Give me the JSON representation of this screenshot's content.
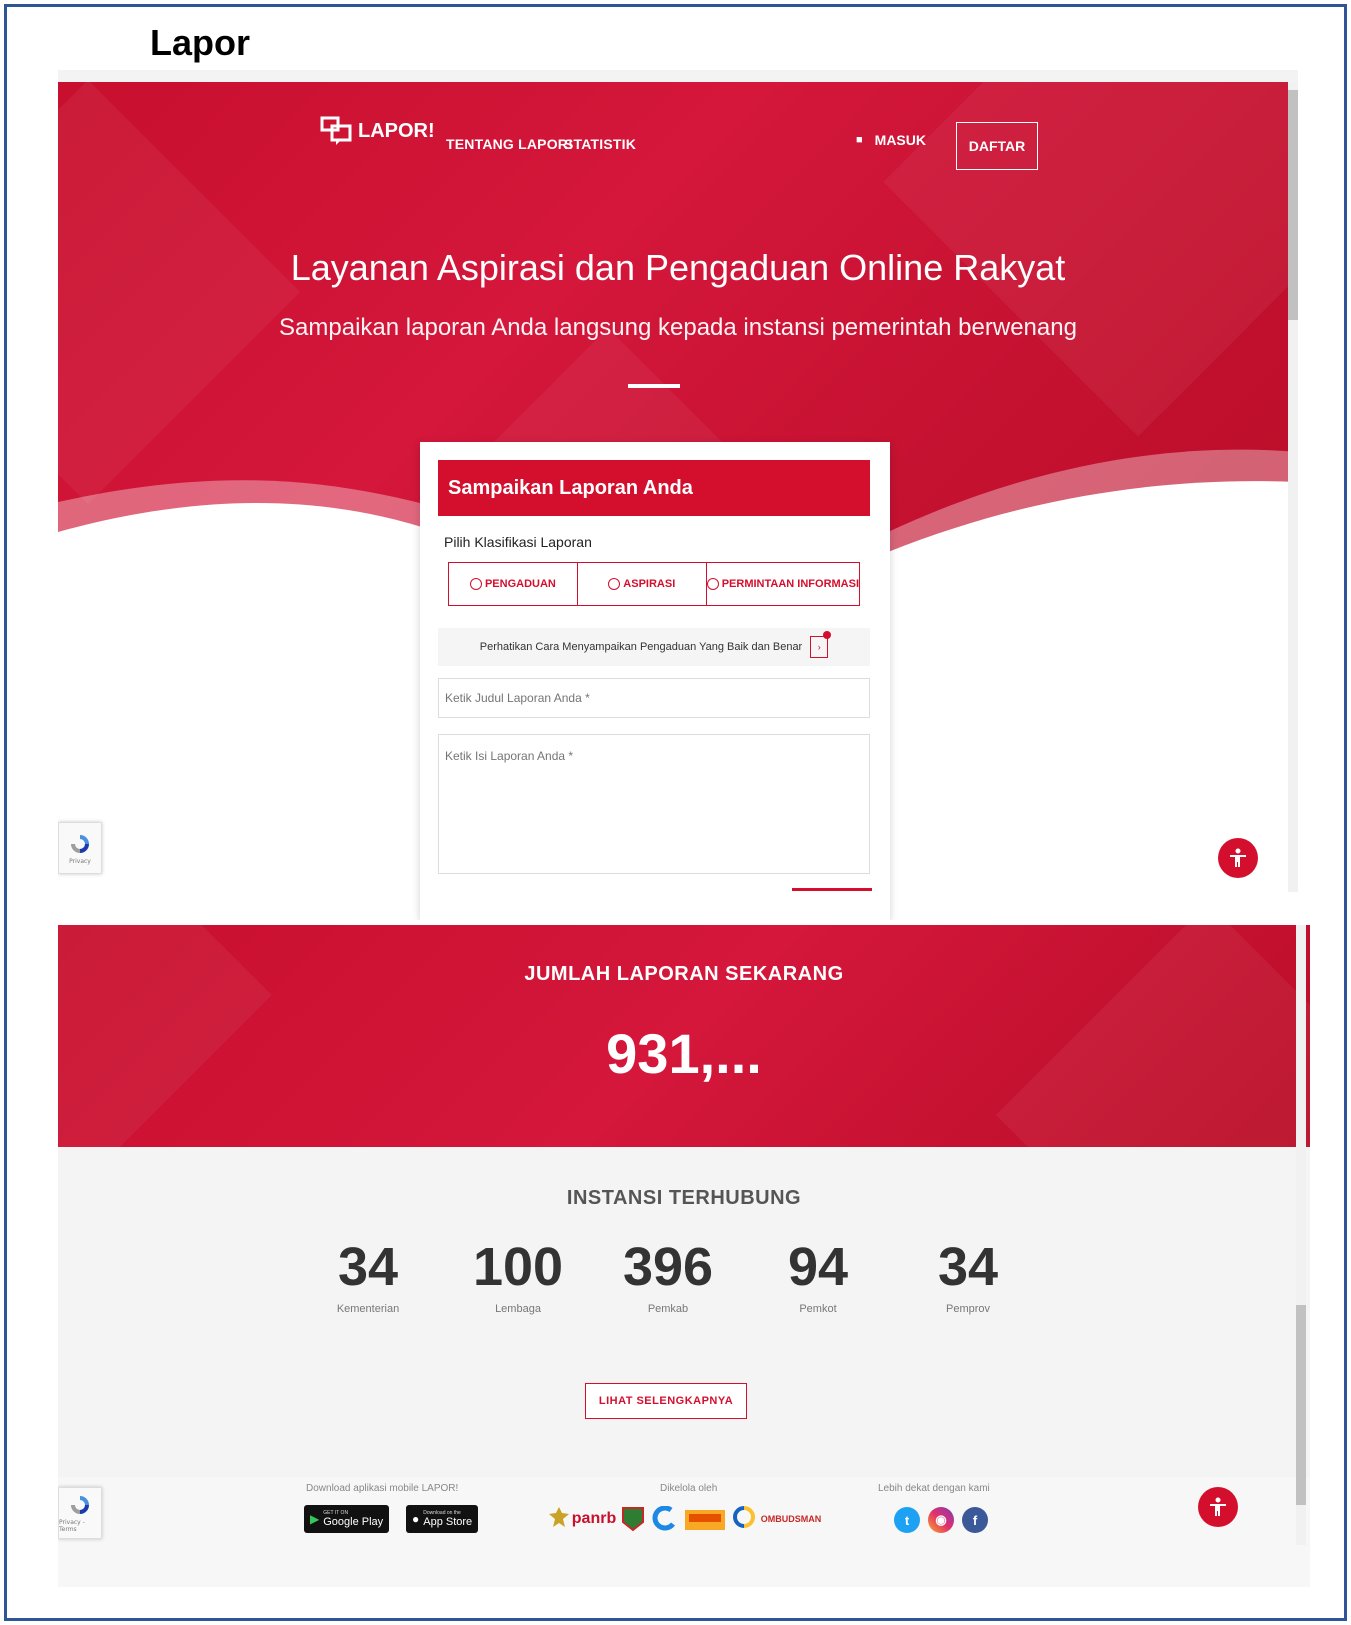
{
  "caption": "Lapor",
  "nav": {
    "logo_text": "LAPOR!",
    "links": [
      "TENTANG LAPOR!",
      "STATISTIK"
    ],
    "login_label": "MASUK",
    "register_label": "DAFTAR"
  },
  "hero": {
    "title": "Layanan Aspirasi dan Pengaduan Online Rakyat",
    "subtitle": "Sampaikan laporan Anda langsung kepada instansi pemerintah berwenang"
  },
  "report_form": {
    "header": "Sampaikan Laporan Anda",
    "classify_label": "Pilih Klasifikasi Laporan",
    "options": [
      "PENGADUAN",
      "ASPIRASI",
      "PERMINTAAN INFORMASI"
    ],
    "hint": "Perhatikan Cara Menyampaikan Pengaduan Yang Baik dan Benar",
    "title_placeholder": "Ketik Judul Laporan Anda *",
    "body_placeholder": "Ketik Isi Laporan Anda *"
  },
  "recaptcha": {
    "label_top": "Privacy",
    "label_bottom": "Privacy - Terms"
  },
  "report_count": {
    "label": "JUMLAH LAPORAN SEKARANG",
    "value": "931,..."
  },
  "institutions": {
    "heading": "INSTANSI TERHUBUNG",
    "stats": [
      {
        "value": "34",
        "label": "Kementerian"
      },
      {
        "value": "100",
        "label": "Lembaga"
      },
      {
        "value": "396",
        "label": "Pemkab"
      },
      {
        "value": "94",
        "label": "Pemkot"
      },
      {
        "value": "34",
        "label": "Pemprov"
      }
    ],
    "more_button": "LIHAT SELENGKAPNYA"
  },
  "footer": {
    "download_caption": "Download aplikasi mobile LAPOR!",
    "google_play": {
      "small": "GET IT ON",
      "big": "Google Play"
    },
    "app_store": {
      "small": "Download on the",
      "big": "App Store"
    },
    "managed_caption": "Dikelola oleh",
    "partners": {
      "panrb": "panrb",
      "ombudsman": "OMBUDSMAN"
    },
    "social_caption": "Lebih dekat dengan kami",
    "social_icons": [
      "twitter-icon",
      "instagram-icon",
      "facebook-icon"
    ]
  },
  "colors": {
    "brand_red": "#d40f2e",
    "frame_blue": "#2f5597"
  }
}
